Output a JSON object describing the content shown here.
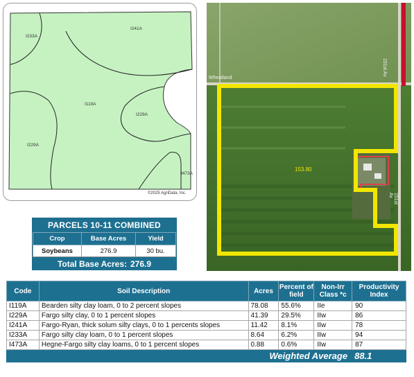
{
  "soil_map": {
    "labels": [
      "I233A",
      "I241A",
      "I119A",
      "I229A",
      "I229A",
      "I473A"
    ],
    "copyright": "©2025 AgriData, Inc."
  },
  "aerial": {
    "road_top": "Wheatland",
    "road_right_top": "151st Av",
    "road_right_mid": "151st Av",
    "field_acres": "153.80"
  },
  "parcel": {
    "title": "PARCELS 10-11 COMBINED",
    "headers": [
      "Crop",
      "Base Acres",
      "Yield"
    ],
    "row": [
      "Soybeans",
      "276.9",
      "30 bu."
    ],
    "total_label": "Total Base Acres:",
    "total_value": "276.9"
  },
  "soil_table": {
    "headers": [
      "Code",
      "Soil Description",
      "Acres",
      "Percent of field",
      "Non-Irr Class *c",
      "Productivity Index"
    ],
    "rows": [
      [
        "I119A",
        "Bearden silty clay loam, 0 to 2 percent slopes",
        "78.08",
        "55.6%",
        "IIe",
        "90"
      ],
      [
        "I229A",
        "Fargo silty clay, 0 to 1 percent slopes",
        "41.39",
        "29.5%",
        "IIw",
        "86"
      ],
      [
        "I241A",
        "Fargo-Ryan, thick solum silty clays, 0 to 1 percents slopes",
        "11.42",
        "8.1%",
        "IIw",
        "78"
      ],
      [
        "I233A",
        "Fargo silty clay loam, 0 to 1 percent slopes",
        "8.64",
        "6.2%",
        "IIw",
        "94"
      ],
      [
        "I473A",
        "Hegne-Fargo silty clay loams, 0 to 1 percent slopes",
        "0.88",
        "0.6%",
        "IIw",
        "87"
      ]
    ],
    "weighted_label": "Weighted Average",
    "weighted_value": "88.1"
  },
  "colors": {
    "header_blue": "#1e7091",
    "soil_green": "#c6f2c2",
    "boundary_yellow": "#f2e600"
  }
}
